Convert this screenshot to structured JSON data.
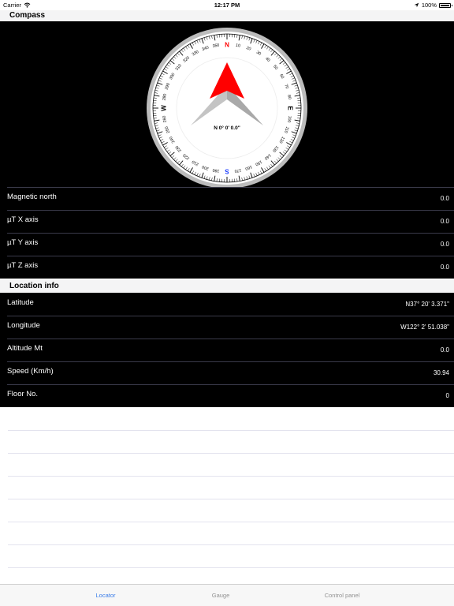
{
  "status_bar": {
    "carrier": "Carrier",
    "time": "12:17 PM",
    "battery": "100%",
    "battery_level": 1.0
  },
  "compass": {
    "section_title": "Compass",
    "readout": "N 0° 0' 0.0\"",
    "heading_degrees": 0,
    "cardinals": {
      "n": "N",
      "e": "E",
      "s": "S",
      "w": "W"
    },
    "degree_labels": [
      "10",
      "20",
      "30",
      "40",
      "50",
      "60",
      "70",
      "80",
      "100",
      "110",
      "120",
      "130",
      "140",
      "150",
      "160",
      "170",
      "190",
      "200",
      "210",
      "220",
      "230",
      "240",
      "250",
      "260",
      "280",
      "290",
      "300",
      "310",
      "320",
      "330",
      "340",
      "350"
    ],
    "needle_color": "#ff0000",
    "north_color": "#ff0000",
    "south_color": "#1a3cff",
    "rows": [
      {
        "label": "Magnetic north",
        "value": "0.0"
      },
      {
        "label": "µT X axis",
        "value": "0.0"
      },
      {
        "label": "µT Y axis",
        "value": "0.0"
      },
      {
        "label": "µT Z axis",
        "value": "0.0"
      }
    ]
  },
  "location": {
    "section_title": "Location info",
    "rows": [
      {
        "label": "Latitude",
        "value": "N37° 20' 3.371\""
      },
      {
        "label": "Longitude",
        "value": "W122° 2' 51.038\""
      },
      {
        "label": "Altitude Mt",
        "value": "0.0"
      },
      {
        "label": "Speed (Km/h)",
        "value": "30.94"
      },
      {
        "label": "Floor No.",
        "value": "0"
      }
    ]
  },
  "tab_bar": {
    "accent": "#3b7de9",
    "tabs": [
      {
        "label": "Locator",
        "active": true
      },
      {
        "label": "Gauge",
        "active": false
      },
      {
        "label": "Control panel",
        "active": false
      }
    ]
  }
}
